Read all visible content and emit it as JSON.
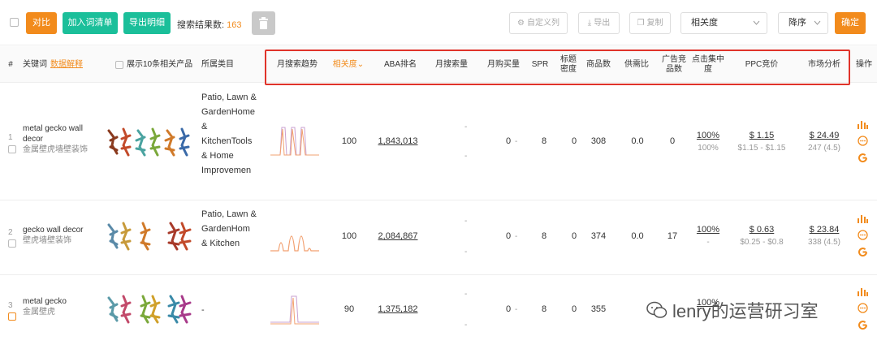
{
  "toolbar": {
    "compare": "对比",
    "add_to_list": "加入词清单",
    "export_detail": "导出明细",
    "result_label": "搜索结果数:",
    "result_count": "163",
    "custom_cols": "自定义列",
    "export": "导出",
    "copy": "复制",
    "sort_field": "相关度",
    "sort_order": "降序",
    "confirm": "确定"
  },
  "header": {
    "hash": "#",
    "keyword": "关键词",
    "keyword_link": "数据解释",
    "show_products": "展示10条相关产品",
    "category": "所属类目",
    "trend": "月搜索趋势",
    "relevance": "相关度",
    "relevance_arrow": "⌄",
    "aba_rank": "ABA排名",
    "monthly_search": "月搜索量",
    "monthly_purchase": "月购买量",
    "spr": "SPR",
    "title_density": "标题密度",
    "products": "商品数",
    "supply_ratio": "供需比",
    "ad_products": "广告竞品数",
    "click_concentration": "点击集中度",
    "ppc": "PPC竞价",
    "market": "市场分析",
    "actions": "操作"
  },
  "rows": [
    {
      "index": "1",
      "keyword": "metal gecko wall decor",
      "keyword_zh": "金属壁虎墙壁装饰",
      "category": "Patio, Lawn & GardenHome & KitchenTools & Home Improvemen",
      "relevance": "100",
      "aba_rank": "1,843,013",
      "monthly_search": "-",
      "monthly_search_sub": "-",
      "monthly_purchase": "0",
      "spr": "8",
      "title_density": "0",
      "products": "308",
      "supply_ratio": "0.0",
      "ad_products": "0",
      "click_concentration": "100%",
      "click_concentration_sub": "100%",
      "ppc_main": "$ 1.15",
      "ppc_range": "$1.15 - $1.15",
      "market_price": "$ 24.49",
      "market_rating": "247 (4.5)"
    },
    {
      "index": "2",
      "keyword": "gecko wall decor",
      "keyword_zh": "壁虎墙壁装饰",
      "category": "Patio, Lawn & GardenHom & Kitchen",
      "relevance": "100",
      "aba_rank": "2,084,867",
      "monthly_search": "-",
      "monthly_search_sub": "-",
      "monthly_purchase": "0",
      "spr": "8",
      "title_density": "0",
      "products": "374",
      "supply_ratio": "0.0",
      "ad_products": "17",
      "click_concentration": "100%",
      "click_concentration_sub": "-",
      "ppc_main": "$ 0.63",
      "ppc_range": "$0.25 - $0.8",
      "market_price": "$ 23.84",
      "market_rating": "338 (4.5)"
    },
    {
      "index": "3",
      "keyword": "metal gecko",
      "keyword_zh": "金属壁虎",
      "category": "-",
      "relevance": "90",
      "aba_rank": "1,375,182",
      "monthly_search": "-",
      "monthly_search_sub": "-",
      "monthly_purchase": "0",
      "spr": "8",
      "title_density": "0",
      "products": "355",
      "click_concentration": "100%"
    }
  ],
  "watermark": "lenry的运营研习室",
  "colors": {
    "accent_orange": "#f28b1c",
    "accent_teal": "#1bbf9a",
    "highlight_red": "#e0332a"
  }
}
